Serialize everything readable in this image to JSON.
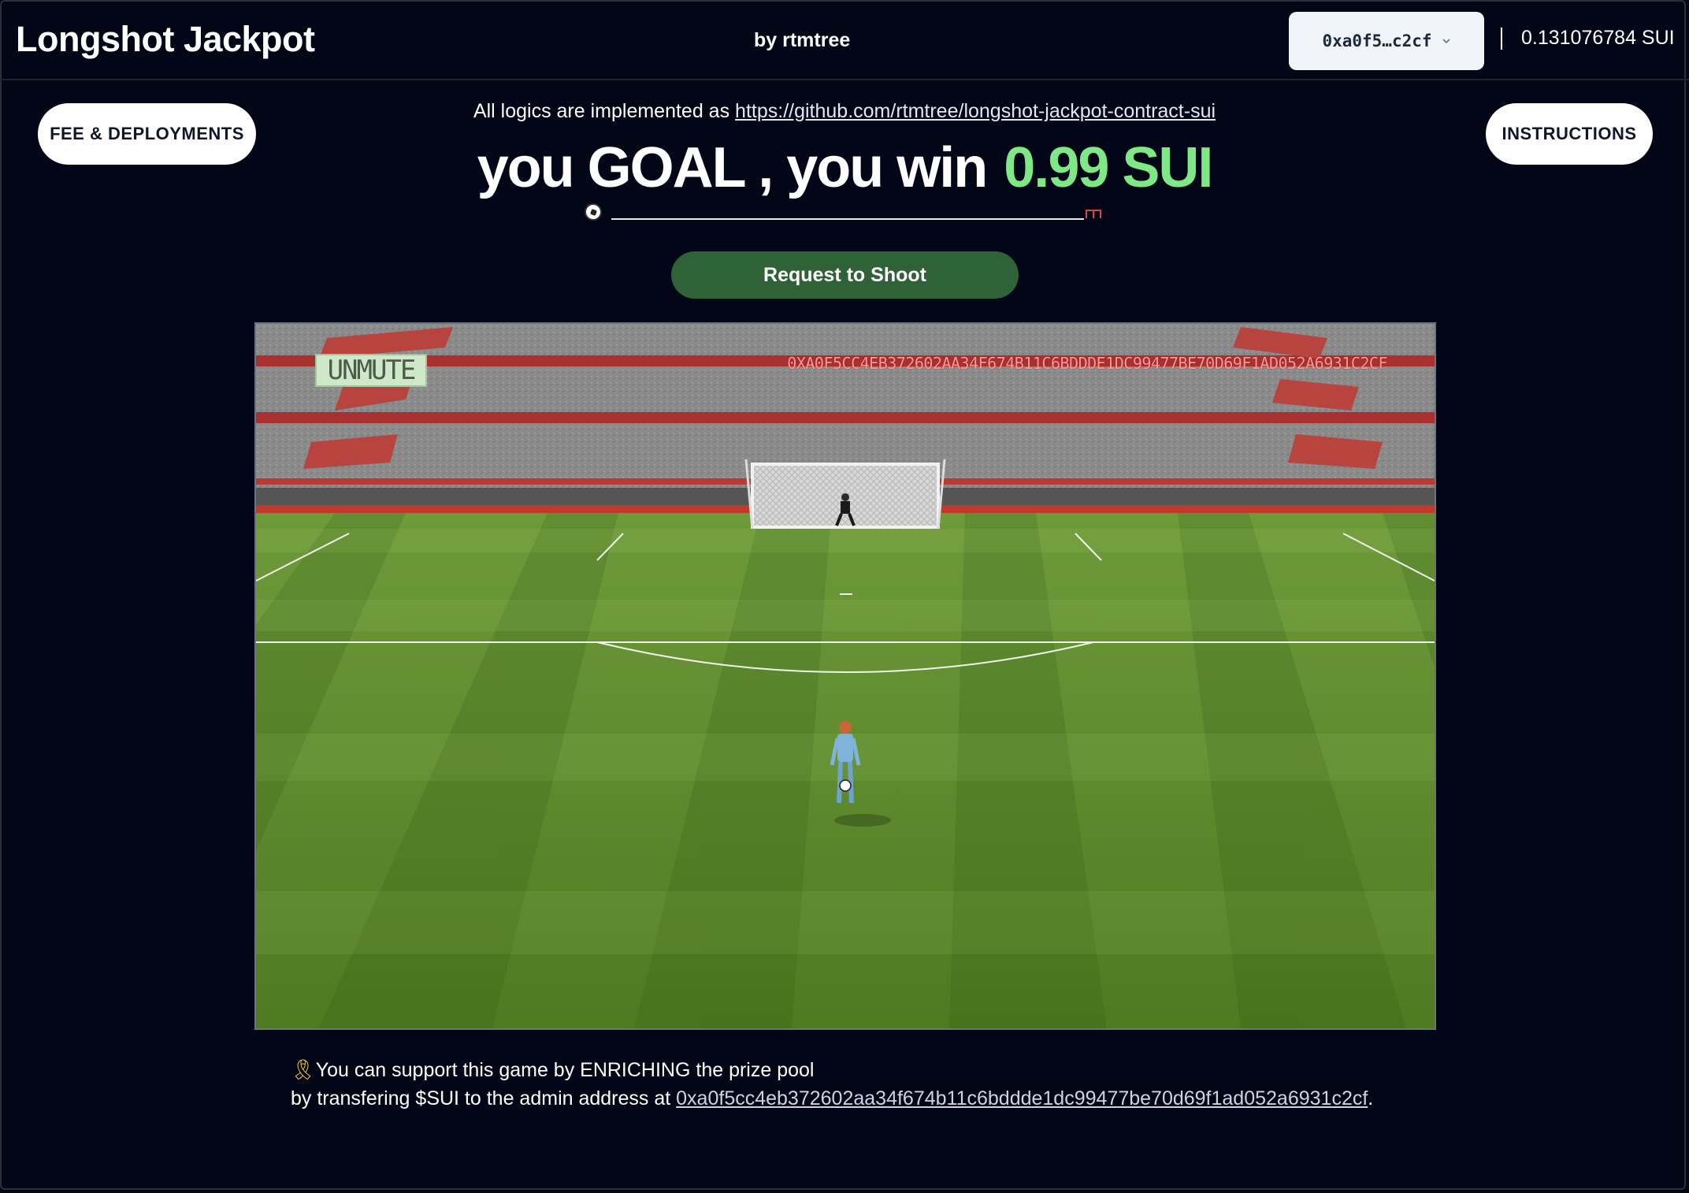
{
  "header": {
    "title": "Longshot Jackpot",
    "byline": "by rtmtree",
    "wallet_short": "0xa0f5…c2cf",
    "balance": "0.131076784 SUI"
  },
  "buttons": {
    "fee": "FEE & DEPLOYMENTS",
    "instructions": "INSTRUCTIONS",
    "shoot": "Request to Shoot"
  },
  "notice": {
    "prefix": "All logics are implemented as",
    "link": "https://github.com/rtmtree/longshot-jackpot-contract-sui"
  },
  "headline": {
    "text": "you GOAL , you win",
    "amount": "0.99 SUI"
  },
  "game": {
    "mute_label": "UNMUTE",
    "banner": "0XA0F5CC4EB372602AA34F674B11C6BDDDE1DC99477BE70D69F1AD052A6931C2CF",
    "progress": 0
  },
  "support": {
    "line1": "You can support this game by ENRICHING the prize pool",
    "line2_prefix": "by transfering $SUI to the admin address at",
    "address": "0xa0f5cc4eb372602aa34f674b11c6bddde1dc99477be70d69f1ad052a6931c2cf",
    "suffix": "."
  },
  "colors": {
    "background": "#020617",
    "amount": "#7ee887",
    "shoot_button": "#2f6236"
  }
}
